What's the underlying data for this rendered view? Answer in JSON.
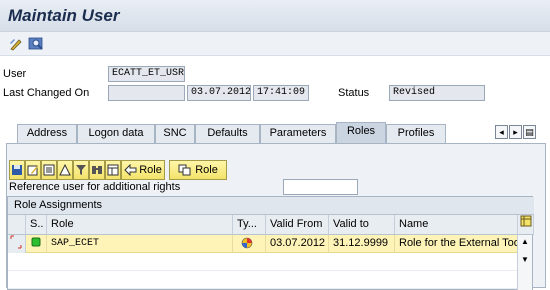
{
  "header": {
    "title": "Maintain User"
  },
  "toolbar": {
    "icons": [
      "display-change-icon",
      "other-user-icon"
    ]
  },
  "form": {
    "user_label": "User",
    "user_value": "ECATT_ET_USR",
    "last_changed_label": "Last Changed On",
    "last_changed_by": "",
    "last_changed_date": "03.07.2012",
    "last_changed_time": "17:41:09",
    "status_label": "Status",
    "status_value": "Revised"
  },
  "tabs": [
    {
      "label": "Address",
      "active": false
    },
    {
      "label": "Logon data",
      "active": false
    },
    {
      "label": "SNC",
      "active": false
    },
    {
      "label": "Defaults",
      "active": false
    },
    {
      "label": "Parameters",
      "active": false
    },
    {
      "label": "Roles",
      "active": true
    },
    {
      "label": "Profiles",
      "active": false
    }
  ],
  "roles_toolbar": {
    "role_btn1": "Role",
    "role_btn2": "Role"
  },
  "reference_user": {
    "label": "Reference user for additional rights",
    "value": ""
  },
  "grid": {
    "title": "Role Assignments",
    "columns": [
      "S..",
      "Role",
      "Ty...",
      "Valid From",
      "Valid to",
      "Name"
    ],
    "rows": [
      {
        "status": "green",
        "role": "SAP_ECET",
        "type": "composite",
        "valid_from": "03.07.2012",
        "valid_to": "31.12.9999",
        "name": "Role for the External Tool"
      }
    ]
  },
  "colors": {
    "title": "#1b2d4f",
    "selected_row": "#fff4b8",
    "button": "#f3e36a"
  }
}
